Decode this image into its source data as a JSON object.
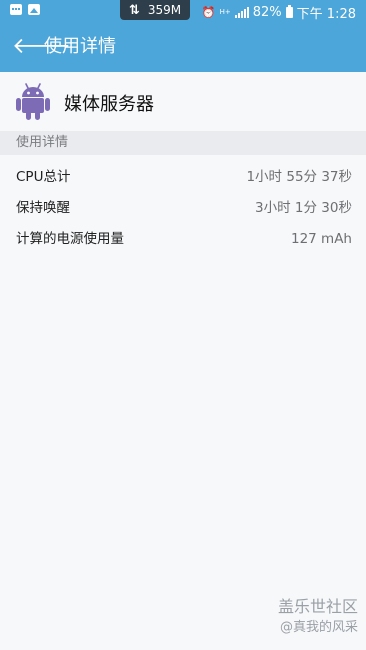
{
  "status_bar": {
    "data_speed": "359M",
    "battery": "82%",
    "time": "下午 1:28",
    "network_type": "H+",
    "icons": [
      "message-icon",
      "image-icon",
      "sync-icon",
      "alarm-icon",
      "signal-icon",
      "battery-icon"
    ]
  },
  "app_bar": {
    "title": "使用详情",
    "background_color": "#4da6d9"
  },
  "app": {
    "name": "媒体服务器",
    "icon": "android-icon",
    "icon_color": "#7d6bb5"
  },
  "section": {
    "title": "使用详情"
  },
  "rows": [
    {
      "label": "CPU总计",
      "value": "1小时 55分 37秒"
    },
    {
      "label": "保持唤醒",
      "value": "3小时 1分 30秒"
    },
    {
      "label": "计算的电源使用量",
      "value": "127 mAh"
    }
  ],
  "watermark": {
    "line1": "盖乐世社区",
    "line2": "@真我的风采"
  }
}
